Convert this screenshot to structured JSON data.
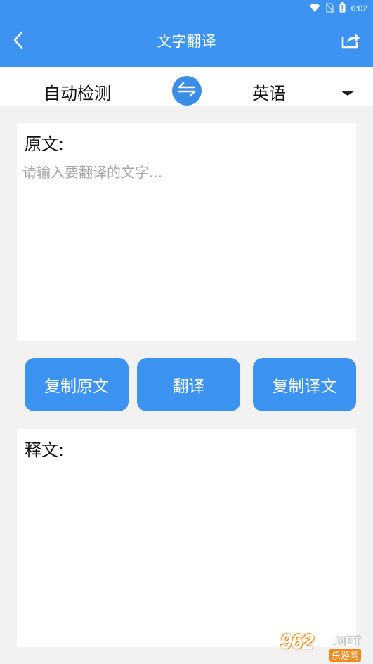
{
  "status_bar": {
    "time": "6:02",
    "icons": [
      "wifi-icon",
      "no-sim-icon",
      "battery-icon"
    ]
  },
  "app_bar": {
    "title": "文字翻译",
    "back_icon": "chevron-left-icon",
    "share_icon": "share-icon"
  },
  "language_bar": {
    "source_language": "自动检测",
    "target_language": "英语",
    "swap_icon": "swap-arrows-icon",
    "dropdown_icon": "caret-down-icon"
  },
  "source_panel": {
    "label": "原文:",
    "placeholder": "请输入要翻译的文字...",
    "value": ""
  },
  "actions": {
    "copy_source": "复制原文",
    "translate": "翻译",
    "copy_result": "复制译文"
  },
  "result_panel": {
    "label": "释文:",
    "value": ""
  },
  "watermark": {
    "number": "962",
    "suffix": ".NET",
    "site": "乐游网"
  },
  "colors": {
    "primary": "#3d93f2",
    "background": "#f2f2f2",
    "placeholder": "#a7a7a7",
    "watermark_orange": "#f08a1c"
  }
}
